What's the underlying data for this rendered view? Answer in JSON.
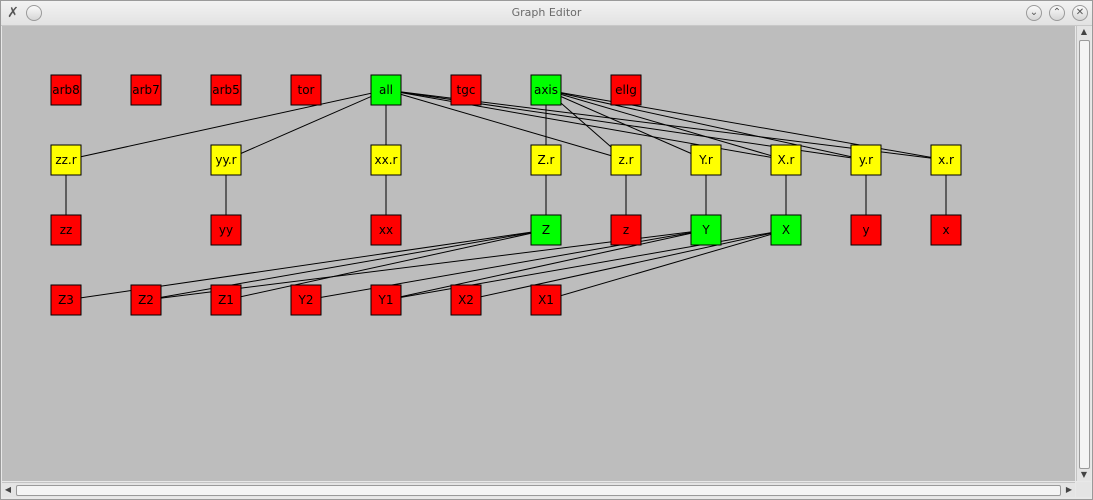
{
  "window": {
    "title": "Graph Editor"
  },
  "titlebar": {
    "app_icon": "x-logo-icon",
    "menu_icon": "circle-menu-icon",
    "buttons": [
      {
        "name": "minimize-button",
        "icon": "chevron-down-icon",
        "glyph": "⌄"
      },
      {
        "name": "maximize-button",
        "icon": "chevron-up-icon",
        "glyph": "⌃"
      },
      {
        "name": "close-button",
        "icon": "close-icon",
        "glyph": "✕"
      }
    ]
  },
  "colors": {
    "red": "#ff0000",
    "yellow": "#ffff00",
    "green": "#00ff00",
    "canvas": "#bdbdbd"
  },
  "graph": {
    "nodes": [
      {
        "id": "arb8",
        "label": "arb8",
        "color": "red"
      },
      {
        "id": "arb7",
        "label": "arb7",
        "color": "red"
      },
      {
        "id": "arb5",
        "label": "arb5",
        "color": "red"
      },
      {
        "id": "tor",
        "label": "tor",
        "color": "red"
      },
      {
        "id": "all",
        "label": "all",
        "color": "green"
      },
      {
        "id": "tgc",
        "label": "tgc",
        "color": "red"
      },
      {
        "id": "axis",
        "label": "axis",
        "color": "green"
      },
      {
        "id": "ellg",
        "label": "ellg",
        "color": "red"
      },
      {
        "id": "zz.r",
        "label": "zz.r",
        "color": "yellow"
      },
      {
        "id": "yy.r",
        "label": "yy.r",
        "color": "yellow"
      },
      {
        "id": "xx.r",
        "label": "xx.r",
        "color": "yellow"
      },
      {
        "id": "Z.r",
        "label": "Z.r",
        "color": "yellow"
      },
      {
        "id": "z.r",
        "label": "z.r",
        "color": "yellow"
      },
      {
        "id": "Y.r",
        "label": "Y.r",
        "color": "yellow"
      },
      {
        "id": "X.r",
        "label": "X.r",
        "color": "yellow"
      },
      {
        "id": "y.r",
        "label": "y.r",
        "color": "yellow"
      },
      {
        "id": "x.r",
        "label": "x.r",
        "color": "yellow"
      },
      {
        "id": "zz",
        "label": "zz",
        "color": "red"
      },
      {
        "id": "yy",
        "label": "yy",
        "color": "red"
      },
      {
        "id": "xx",
        "label": "xx",
        "color": "red"
      },
      {
        "id": "Z",
        "label": "Z",
        "color": "green"
      },
      {
        "id": "z",
        "label": "z",
        "color": "red"
      },
      {
        "id": "Y",
        "label": "Y",
        "color": "green"
      },
      {
        "id": "X",
        "label": "X",
        "color": "green"
      },
      {
        "id": "y",
        "label": "y",
        "color": "red"
      },
      {
        "id": "x",
        "label": "x",
        "color": "red"
      },
      {
        "id": "Z3",
        "label": "Z3",
        "color": "red"
      },
      {
        "id": "Z2",
        "label": "Z2",
        "color": "red"
      },
      {
        "id": "Z1",
        "label": "Z1",
        "color": "red"
      },
      {
        "id": "Y2",
        "label": "Y2",
        "color": "red"
      },
      {
        "id": "Y1",
        "label": "Y1",
        "color": "red"
      },
      {
        "id": "X2",
        "label": "X2",
        "color": "red"
      },
      {
        "id": "X1",
        "label": "X1",
        "color": "red"
      }
    ],
    "edges": [
      [
        "all",
        "zz.r"
      ],
      [
        "all",
        "yy.r"
      ],
      [
        "all",
        "xx.r"
      ],
      [
        "all",
        "z.r"
      ],
      [
        "all",
        "X.r"
      ],
      [
        "all",
        "y.r"
      ],
      [
        "all",
        "x.r"
      ],
      [
        "axis",
        "Z.r"
      ],
      [
        "axis",
        "z.r"
      ],
      [
        "axis",
        "Y.r"
      ],
      [
        "axis",
        "X.r"
      ],
      [
        "axis",
        "y.r"
      ],
      [
        "axis",
        "x.r"
      ],
      [
        "zz.r",
        "zz"
      ],
      [
        "yy.r",
        "yy"
      ],
      [
        "xx.r",
        "xx"
      ],
      [
        "Z.r",
        "Z"
      ],
      [
        "z.r",
        "z"
      ],
      [
        "Y.r",
        "Y"
      ],
      [
        "X.r",
        "X"
      ],
      [
        "y.r",
        "y"
      ],
      [
        "x.r",
        "x"
      ],
      [
        "Z",
        "Z3"
      ],
      [
        "Z",
        "Z2"
      ],
      [
        "Z",
        "Z1"
      ],
      [
        "Y",
        "Z2"
      ],
      [
        "Y",
        "Y2"
      ],
      [
        "Y",
        "Y1"
      ],
      [
        "X",
        "Y1"
      ],
      [
        "X",
        "X2"
      ],
      [
        "X",
        "X1"
      ]
    ]
  }
}
